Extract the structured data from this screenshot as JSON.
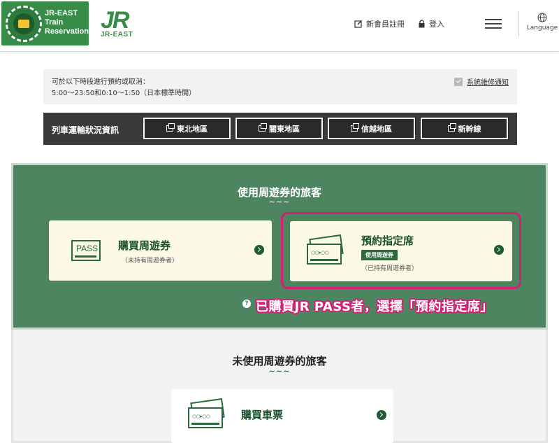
{
  "header": {
    "logo_text": "JR-EAST\nTrain\nReservation",
    "jr_mark": "JR",
    "jr_sub": "JR-EAST",
    "register_label": "新會員註冊",
    "login_label": "登入",
    "language_label": "Language"
  },
  "notice": {
    "line1": "可於以下時段進行預約或取消：",
    "line2": "5:00～23:50和0:10～1:50（日本標準時間）",
    "maintenance_link": "系統維修通知"
  },
  "train_status": {
    "label": "列車運輸狀況資訊",
    "regions": [
      "東北地區",
      "關東地區",
      "信越地區",
      "新幹線"
    ]
  },
  "pass_section": {
    "title": "使用周遊券的旅客",
    "wave": "~~~",
    "buy_card": {
      "title": "購買周遊券",
      "subtitle": "（未持有周遊券者）",
      "icon_text": "PASS"
    },
    "reserve_card": {
      "title": "預約指定席",
      "badge": "使用周遊券",
      "subtitle": "（已持有周遊券者）"
    },
    "help_mark": "?",
    "annotation": "已購買JR PASS者，選擇「預約指定席」"
  },
  "ticket_section": {
    "title": "未使用周遊券的旅客",
    "wave": "~~~",
    "buy_ticket_card": {
      "title": "購買車票"
    }
  },
  "colors": {
    "brand_green": "#378c48",
    "section_green": "#4e8561",
    "card_cream": "#fbf8e6",
    "highlight_pink": "#d41f74",
    "status_bar": "#3a3a3a"
  }
}
